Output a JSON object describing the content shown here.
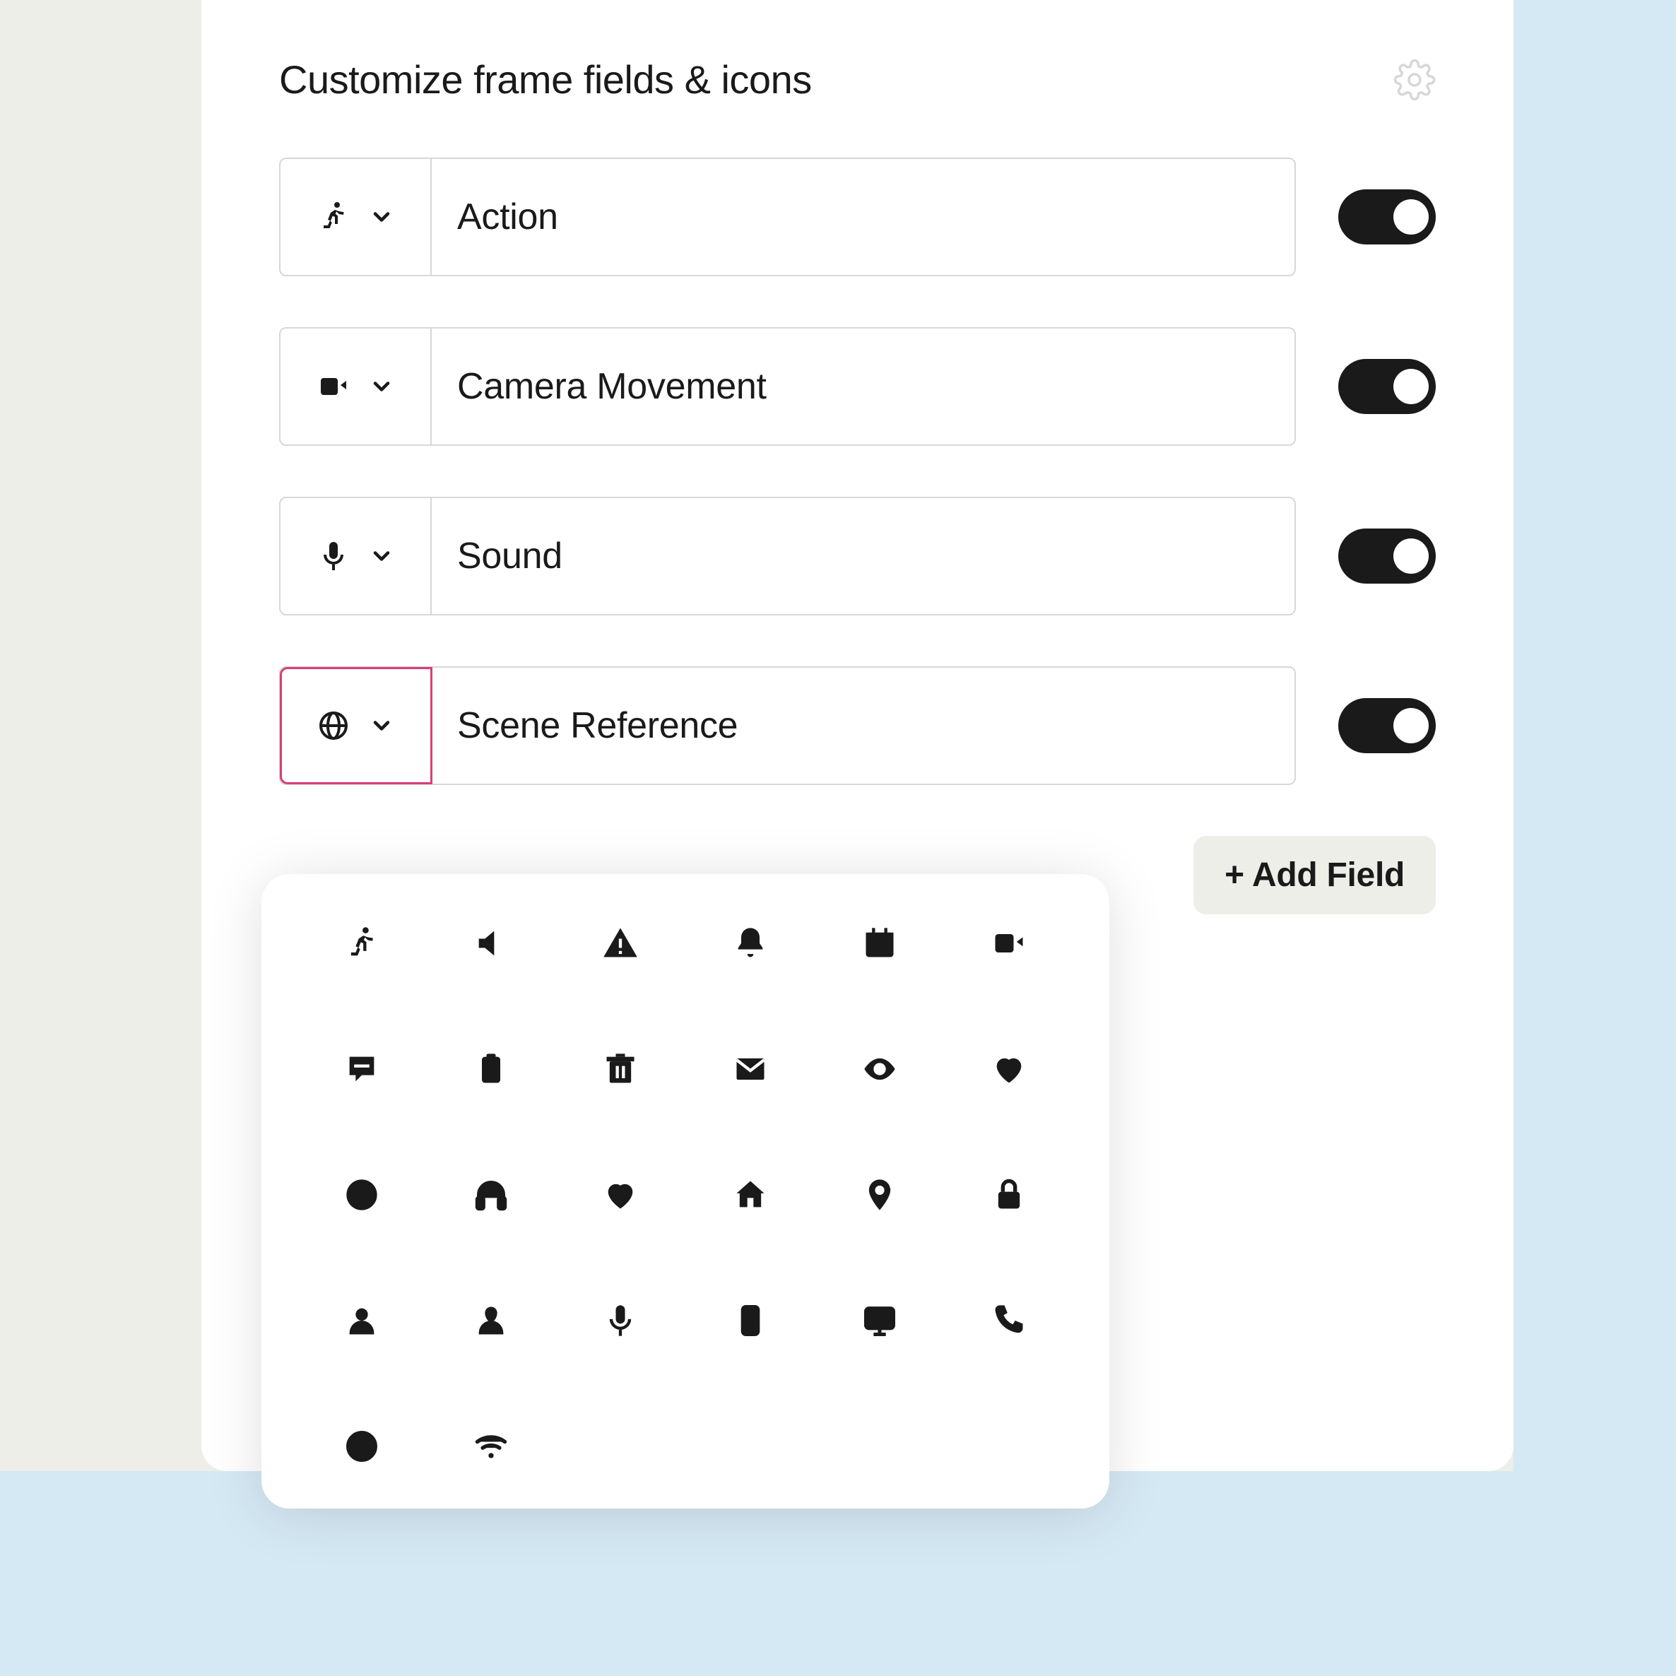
{
  "header": {
    "title": "Customize frame fields & icons"
  },
  "fields": [
    {
      "icon": "run-icon",
      "label": "Action",
      "enabled": true,
      "picker_open": false
    },
    {
      "icon": "video-icon",
      "label": "Camera Movement",
      "enabled": true,
      "picker_open": false
    },
    {
      "icon": "mic-icon",
      "label": "Sound",
      "enabled": true,
      "picker_open": false
    },
    {
      "icon": "globe-icon",
      "label": "Scene Reference",
      "enabled": true,
      "picker_open": true
    }
  ],
  "add_field_label": "+ Add Field",
  "icon_palette": [
    "run-icon",
    "volume-icon",
    "alert-icon",
    "bell-icon",
    "calendar-icon",
    "video-icon",
    "chat-icon",
    "clipboard-icon",
    "trash-icon",
    "mail-icon",
    "eye-icon",
    "heart-icon",
    "globe-icon",
    "headphones-icon",
    "heart-filled-icon",
    "home-icon",
    "pin-icon",
    "lock-icon",
    "user-icon",
    "user-alt-icon",
    "mic-icon",
    "smartphone-icon",
    "monitor-icon",
    "phone-icon",
    "lifebuoy-icon",
    "wifi-icon"
  ]
}
